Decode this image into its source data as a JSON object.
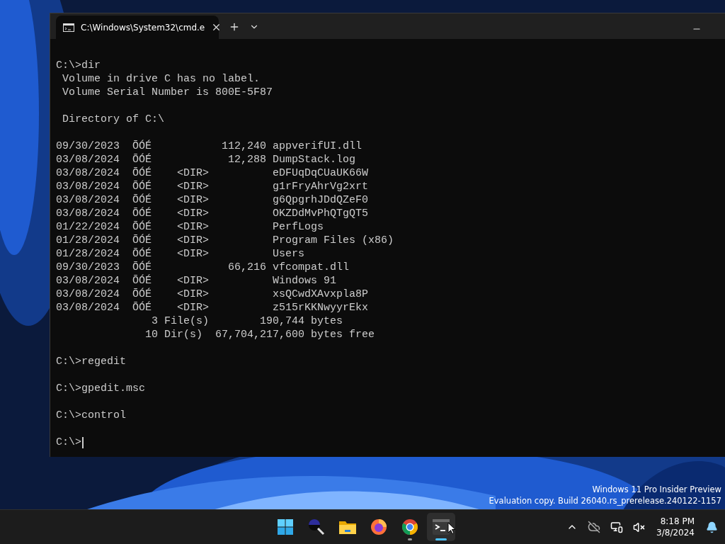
{
  "window": {
    "tab": {
      "title": "C:\\Windows\\System32\\cmd.e",
      "selected": true
    },
    "blocks": [
      [
        "C:\\>dir",
        " Volume in drive C has no label.",
        " Volume Serial Number is 800E-5F87"
      ],
      [
        " Directory of C:\\"
      ],
      [
        "09/30/2023  ÕÓÉ           112,240 appverifUI.dll",
        "03/08/2024  ÕÓÉ            12,288 DumpStack.log",
        "03/08/2024  ÕÓÉ    <DIR>          eDFUqDqCUaUK66W",
        "03/08/2024  ÕÓÉ    <DIR>          g1rFryAhrVg2xrt",
        "03/08/2024  ÕÓÉ    <DIR>          g6QpgrhJDdQZeF0",
        "03/08/2024  ÕÓÉ    <DIR>          OKZDdMvPhQTgQT5",
        "01/22/2024  ÕÓÉ    <DIR>          PerfLogs",
        "01/28/2024  ÕÓÉ    <DIR>          Program Files (x86)",
        "01/28/2024  ÕÓÉ    <DIR>          Users",
        "09/30/2023  ÕÓÉ            66,216 vfcompat.dll",
        "03/08/2024  ÕÓÉ    <DIR>          Windows 91",
        "03/08/2024  ÕÓÉ    <DIR>          xsQCwdXAvxpla8P",
        "03/08/2024  ÕÓÉ    <DIR>          z515rKKNwyyrEkx",
        "               3 File(s)        190,744 bytes",
        "              10 Dir(s)  67,704,217,600 bytes free"
      ],
      [
        "C:\\>regedit"
      ],
      [
        "C:\\>gpedit.msc"
      ],
      [
        "C:\\>control"
      ],
      [
        "C:\\>"
      ]
    ]
  },
  "watermark": [
    "Windows 11 Pro Insider Preview",
    "Evaluation copy. Build 26040.rs_prerelease.240122-1157"
  ],
  "taskbar": {
    "apps": [
      {
        "kind": "start",
        "running": false,
        "selected": false
      },
      {
        "kind": "search",
        "running": false,
        "selected": false
      },
      {
        "kind": "folder",
        "running": false,
        "selected": false
      },
      {
        "kind": "firefox",
        "running": false,
        "selected": false
      },
      {
        "kind": "chrome",
        "running": true,
        "selected": false
      },
      {
        "kind": "terminal",
        "running": true,
        "selected": true
      }
    ],
    "clock": {
      "time": "8:18 PM",
      "date": "3/8/2024"
    }
  }
}
